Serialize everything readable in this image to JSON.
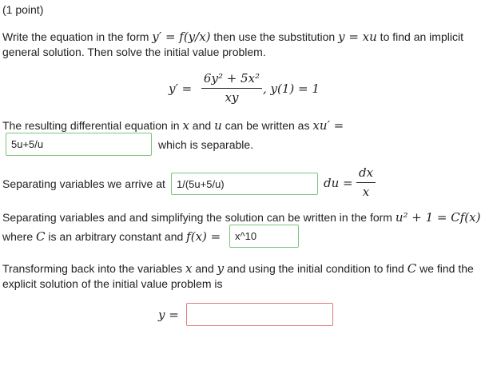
{
  "points_label": "(1 point)",
  "intro": {
    "text_a": "Write the equation in the form ",
    "eq_form": "y′ = f(y/x)",
    "text_b": " then use the substitution ",
    "eq_sub": "y = xu",
    "text_c": " to find an implicit",
    "line2": "general solution. Then solve the initial value problem."
  },
  "problem": {
    "lhs": "y′ =",
    "numerator": "6y² + 5x²",
    "denominator": "xy",
    "ivp": ",  y(1) = 1"
  },
  "step1": {
    "text": "The resulting differential equation in ",
    "v1": "x",
    "and": " and ",
    "v2": "u",
    "tail": " can be written as ",
    "eq": "xu′ =",
    "answer": "5u+5/u",
    "after": "which is separable."
  },
  "step2": {
    "text": "Separating variables we arrive at",
    "answer": "1/(5u+5/u)",
    "du_eq": "du =",
    "dx": "dx",
    "x": "x"
  },
  "step3": {
    "text_a": "Separating variables and and simplifying the solution can be written in the form ",
    "eq": "u² + 1 = Cf(x)",
    "where": "where ",
    "C": "C",
    "mid": " is an arbitrary constant and ",
    "f_eq": "f(x) =",
    "answer": "x^10"
  },
  "step4": {
    "text_a": "Transforming back into the variables ",
    "x": "x",
    "and": " and ",
    "y": "y",
    "text_b": " and using the initial condition to find ",
    "C": "C",
    "text_c": " we find the",
    "line2": "explicit solution of the initial value problem is",
    "lhs": "y =",
    "answer": ""
  },
  "colors": {
    "correct_border": "#7fc47f",
    "empty_border": "#e07c7c"
  }
}
